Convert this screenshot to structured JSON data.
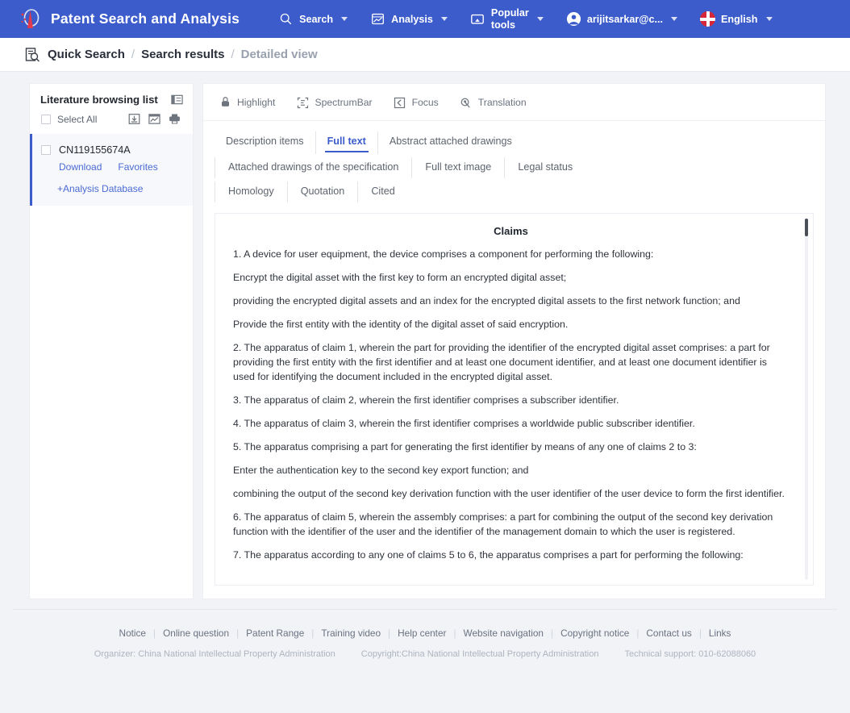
{
  "topnav": {
    "brand_title": "Patent Search and Analysis",
    "logo_icon": "patent-logo-icon",
    "items": [
      {
        "label": "Search",
        "icon": "search-icon",
        "caret": true
      },
      {
        "label": "Analysis",
        "icon": "analysis-chart-icon",
        "caret": true
      },
      {
        "label_line1": "Popular",
        "label_line2": "tools",
        "icon": "popular-tools-icon",
        "caret": true
      },
      {
        "label": "arijitsarkar@c...",
        "icon": "user-account-icon",
        "caret": true
      },
      {
        "label": "English",
        "icon": "uk-flag-icon",
        "caret": true
      }
    ]
  },
  "breadcrumb": {
    "icon": "document-search-icon",
    "items": [
      {
        "label": "Quick Search",
        "active": true
      },
      {
        "label": "Search results",
        "active": true
      },
      {
        "label": "Detailed view",
        "active": false
      }
    ],
    "separator": "/"
  },
  "sidebar": {
    "title": "Literature browsing list",
    "collapse_icon": "collapse-panel-icon",
    "select_all_label": "Select All",
    "tool_icons": [
      "download-icon",
      "export-image-icon",
      "print-icon"
    ],
    "items": [
      {
        "id": "CN119155674A",
        "links": [
          "Download",
          "Favorites"
        ],
        "add_label": "+Analysis Database"
      }
    ]
  },
  "doc_toolbar": [
    {
      "label": "Highlight",
      "icon": "highlighter-icon"
    },
    {
      "label": "SpectrumBar",
      "icon": "spectrum-bar-icon"
    },
    {
      "label": "Focus",
      "icon": "focus-icon"
    },
    {
      "label": "Translation",
      "icon": "translation-icon"
    }
  ],
  "tabs": {
    "row1": [
      {
        "label": "Description items",
        "active": false
      },
      {
        "label": "Full text",
        "active": true
      },
      {
        "label": "Abstract attached drawings",
        "active": false
      }
    ],
    "row2": [
      {
        "label": "Attached drawings of the specification",
        "active": false
      },
      {
        "label": "Full text image",
        "active": false
      },
      {
        "label": "Legal status",
        "active": false
      }
    ],
    "row3": [
      {
        "label": "Homology",
        "active": false
      },
      {
        "label": "Quotation",
        "active": false
      },
      {
        "label": "Cited",
        "active": false
      }
    ]
  },
  "document": {
    "title": "Claims",
    "paragraphs": [
      "1. A device for user equipment, the device comprises a component for performing the following:",
      "Encrypt the digital asset with the first key to form an encrypted digital asset;",
      "providing the encrypted digital assets and an index for the encrypted digital assets to the first network function; and",
      "Provide the first entity with the identity of the digital asset of said encryption.",
      "2. The apparatus of claim 1, wherein the part for providing the identifier of the encrypted digital asset comprises: a part for providing the first entity with the first identifier and at least one document identifier, and at least one document identifier is used for identifying the document included in the encrypted digital asset.",
      "3. The apparatus of claim 2, wherein the first identifier comprises a subscriber identifier.",
      "4. The apparatus of claim 3, wherein the first identifier comprises a worldwide public subscriber identifier.",
      "5. The apparatus comprising a part for generating the first identifier by means of any one of claims 2 to 3:",
      "Enter the authentication key to the second key export function; and",
      "combining the output of the second key derivation function with the user identifier of the user device to form the first identifier.",
      "6. The apparatus of claim 5, wherein the assembly comprises: a part for combining the output of the second key derivation function with the identifier of the user and the identifier of the management domain to which the user is registered.",
      "7. The apparatus according to any one of claims 5 to 6, the apparatus comprises a part for performing the following:"
    ]
  },
  "footer": {
    "links": [
      "Notice",
      "Online question",
      "Patent Range",
      "Training video",
      "Help center",
      "Website navigation",
      "Copyright notice",
      "Contact us",
      "Links"
    ],
    "meta": [
      "Organizer: China National Intellectual Property Administration",
      "Copyright:China National Intellectual Property Administration",
      "Technical support: 010-62088060"
    ]
  },
  "colors": {
    "brand_blue": "#3c5ccc",
    "link_blue": "#4a6ad4",
    "page_bg": "#f1f3f7",
    "text_dark": "#23272f",
    "text_muted": "#6b7280"
  }
}
